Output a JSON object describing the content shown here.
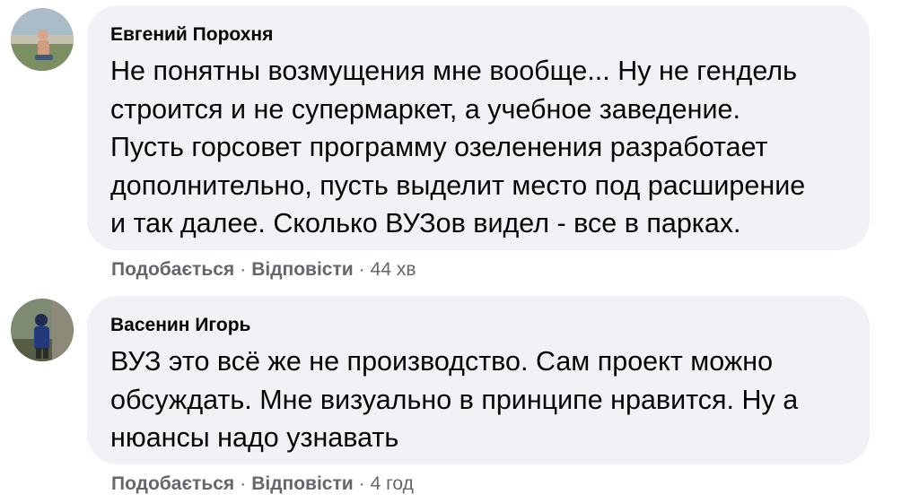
{
  "comments": [
    {
      "author": "Евгений Порохня",
      "lines": [
        "Не понятны возмущения мне вообще... Ну не гендель",
        "строится и не супермаркет, а учебное заведение.",
        "Пусть горсовет программу озеленения разработает",
        "дополнительно, пусть выделит место под расширение",
        "и так далее. Сколько ВУЗов видел - все в парках."
      ],
      "like_label": "Подобається",
      "reply_label": "Відповісти",
      "separator": "·",
      "time": "44 хв",
      "avatar_colors": {
        "sky": "#9fb7c8",
        "ground": "#6f8a5a",
        "figure": "#d9a88a"
      }
    },
    {
      "author": "Васенин Игорь",
      "lines": [
        "ВУЗ это всё же не производство. Сам проект можно",
        "обсуждать. Мне визуально в принципе нравится. Ну а",
        "нюансы надо узнавать"
      ],
      "like_label": "Подобається",
      "reply_label": "Відповісти",
      "separator": "·",
      "time": "4 год",
      "avatar_colors": {
        "sky": "#7d8a70",
        "ground": "#4f5a3c",
        "figure": "#2a3f7a"
      }
    }
  ],
  "colors": {
    "bubble": "#f0f2f5",
    "text": "#050505",
    "meta": "#65676b"
  }
}
